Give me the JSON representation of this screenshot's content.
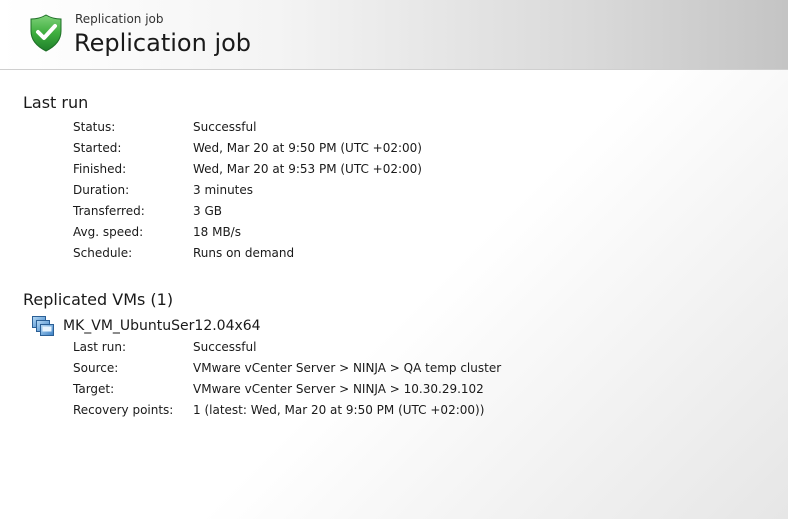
{
  "header": {
    "subtitle": "Replication job",
    "title": "Replication job",
    "icon": "green-shield-check-icon"
  },
  "last_run": {
    "heading": "Last run",
    "rows": [
      {
        "label": "Status:",
        "value": "Successful"
      },
      {
        "label": "Started:",
        "value": "Wed, Mar 20 at 9:50 PM (UTC +02:00)"
      },
      {
        "label": "Finished:",
        "value": "Wed, Mar 20 at 9:53 PM (UTC +02:00)"
      },
      {
        "label": "Duration:",
        "value": "3 minutes"
      },
      {
        "label": "Transferred:",
        "value": "3 GB"
      },
      {
        "label": "Avg. speed:",
        "value": "18 MB/s"
      },
      {
        "label": "Schedule:",
        "value": "Runs on demand"
      }
    ]
  },
  "replicated_vms": {
    "heading": "Replicated VMs (1)",
    "vms": [
      {
        "name": "MK_VM_UbuntuSer12.04x64",
        "icon": "virtual-machine-icon",
        "rows": [
          {
            "label": "Last run:",
            "value": "Successful"
          },
          {
            "label": "Source:",
            "value": "VMware vCenter Server > NINJA > QA temp cluster"
          },
          {
            "label": "Target:",
            "value": "VMware vCenter Server > NINJA > 10.30.29.102"
          },
          {
            "label": "Recovery points:",
            "value": "1 (latest: Wed, Mar 20 at 9:50 PM (UTC +02:00))"
          }
        ]
      }
    ]
  },
  "colors": {
    "shield_green": "#2fa84f",
    "vm_icon_blue": "#3a7fc4"
  }
}
